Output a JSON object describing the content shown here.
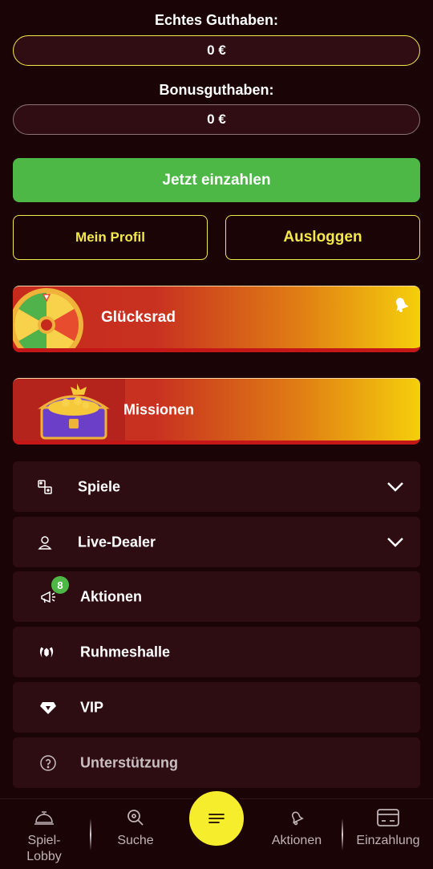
{
  "balances": {
    "real_label": "Echtes Guthaben:",
    "real_value": "0 €",
    "bonus_label": "Bonusguthaben:",
    "bonus_value": "0 €"
  },
  "actions": {
    "deposit_label": "Jetzt einzahlen",
    "profile_label": "Mein Profil",
    "logout_label": "Ausloggen"
  },
  "promos": [
    {
      "label": "Glücksrad",
      "icon": "wheel-of-fortune-icon"
    },
    {
      "label": "Missionen",
      "icon": "treasure-chest-icon"
    }
  ],
  "menu": [
    {
      "label": "Spiele",
      "icon": "games-icon",
      "expandable": true
    },
    {
      "label": "Live-Dealer",
      "icon": "dealer-icon",
      "expandable": true
    },
    {
      "label": "Aktionen",
      "icon": "megaphone-icon",
      "badge": "8"
    },
    {
      "label": "Ruhmeshalle",
      "icon": "laurel-icon"
    },
    {
      "label": "VIP",
      "icon": "diamond-icon"
    },
    {
      "label": "Unterstützung",
      "icon": "help-icon"
    }
  ],
  "bottom_nav": [
    {
      "label": "Spiel-\nLobby",
      "icon": "bell-desk-icon"
    },
    {
      "label": "Suche",
      "icon": "search-icon"
    },
    {
      "label": "Aktionen",
      "icon": "bell-icon"
    },
    {
      "label": "Einzahlung",
      "icon": "card-icon"
    }
  ],
  "colors": {
    "background": "#1b0406",
    "accent_yellow": "#f3e94a",
    "deposit_green": "#4db846",
    "menu_bg": "#2e0d12",
    "fab_yellow": "#f6ee2c"
  }
}
